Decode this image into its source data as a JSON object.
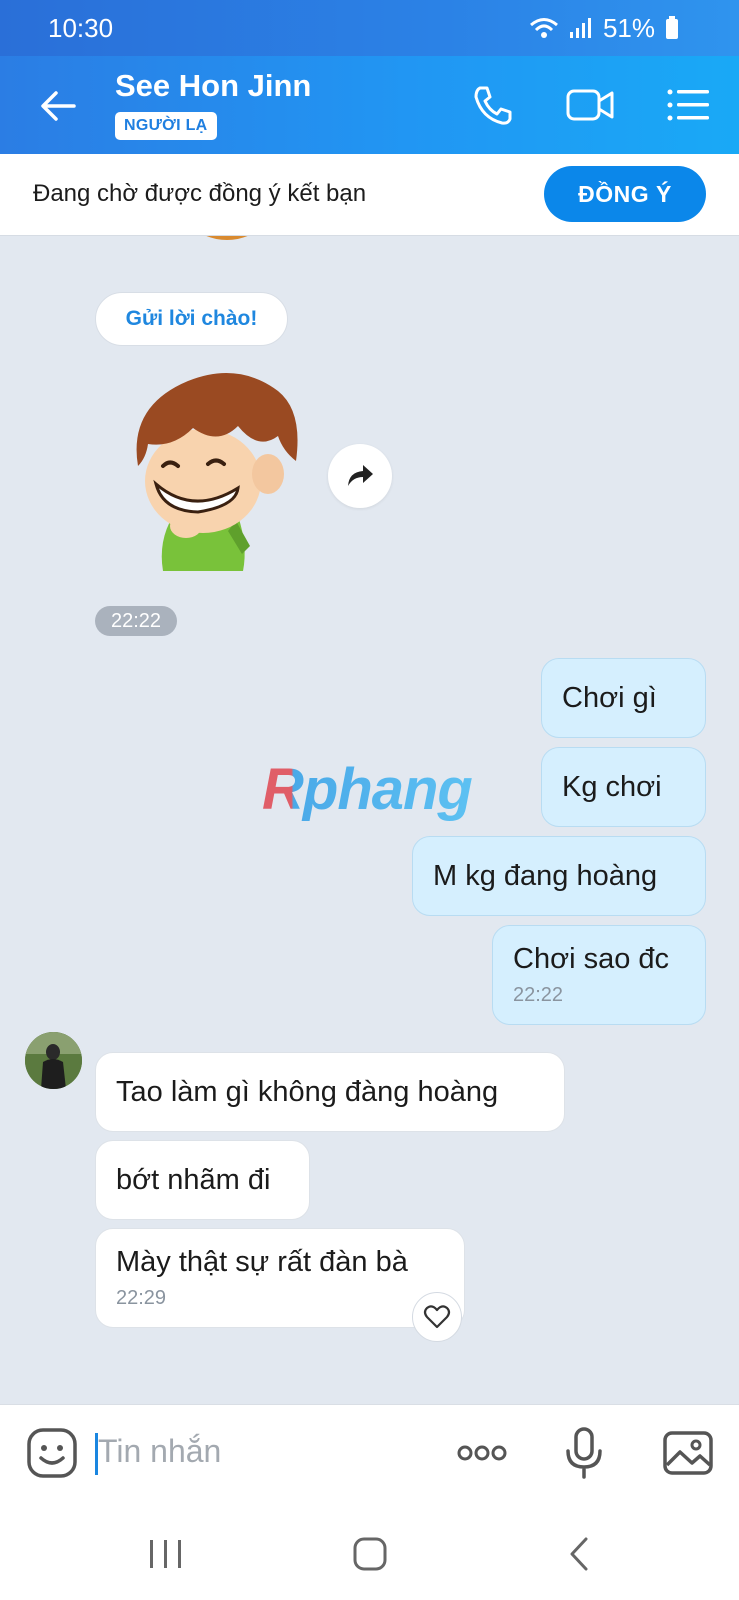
{
  "status_bar": {
    "time": "10:30",
    "battery": "51%"
  },
  "header": {
    "contact_name": "See Hon Jinn",
    "badge": "NGƯỜI LẠ"
  },
  "pending": {
    "text": "Đang chờ được đồng ý kết bạn",
    "accept_label": "ĐỒNG Ý"
  },
  "chat": {
    "greet_label": "Gửi lời chào!",
    "sticker_time": "22:22",
    "watermark": "Rphang",
    "outgoing": [
      {
        "text": "Chơi gì"
      },
      {
        "text": "Kg chơi"
      },
      {
        "text": "M kg đang hoàng"
      },
      {
        "text": "Chơi sao đc",
        "time": "22:22"
      }
    ],
    "incoming": [
      {
        "text": "Tao làm gì không đàng hoàng"
      },
      {
        "text": "bớt nhãm đi"
      },
      {
        "text": "Mày thật sự rất đàn bà",
        "time": "22:29"
      }
    ]
  },
  "composer": {
    "placeholder": "Tin nhắn"
  },
  "colors": {
    "accent": "#0b87ea",
    "header_start": "#2b7de4",
    "header_end": "#19a9f6",
    "bubble_out": "#d5effe",
    "bg": "#e2e8f0"
  },
  "icons": [
    "back-arrow-icon",
    "phone-icon",
    "video-camera-icon",
    "menu-list-icon",
    "share-forward-icon",
    "heart-icon",
    "emoji-sticker-icon",
    "more-dots-icon",
    "microphone-icon",
    "image-gallery-icon",
    "recent-apps-icon",
    "home-icon",
    "back-nav-icon"
  ]
}
